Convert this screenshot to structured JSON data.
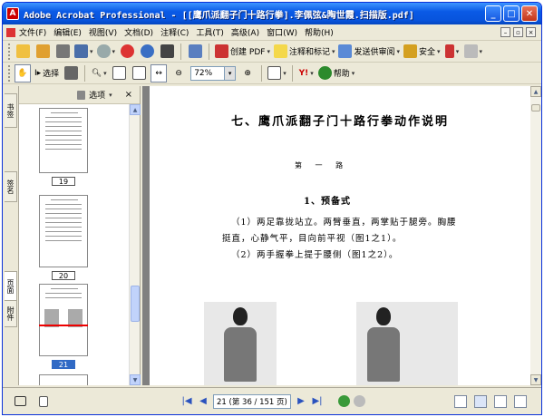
{
  "window": {
    "title": "Adobe Acrobat Professional - [[鹰爪派翻子门十路行拳].李佩弦&陶世霞.扫描版.pdf]",
    "app_icon": "acrobat-icon"
  },
  "menu": {
    "items": [
      "文件(F)",
      "编辑(E)",
      "视图(V)",
      "文档(D)",
      "注释(C)",
      "工具(T)",
      "高级(A)",
      "窗口(W)",
      "帮助(H)"
    ]
  },
  "toolbar1": {
    "create_pdf": "创建 PDF",
    "comment_markup": "注释和标记",
    "send_review": "发送供审阅",
    "secure": "安全"
  },
  "toolbar2": {
    "select": "选择",
    "zoom_value": "72%",
    "help": "帮助"
  },
  "left_tabs": [
    "书签",
    "签名",
    "页面",
    "附件"
  ],
  "nav_panel": {
    "options": "选项",
    "close": "×",
    "thumb_labels": [
      "19",
      "20",
      "21"
    ],
    "selected": "21"
  },
  "document": {
    "title": "七、鹰爪派翻子门十路行拳动作说明",
    "chapter": "第 一 路",
    "section": "1、预备式",
    "paragraphs": [
      "（1）两足靠拢站立。两臂垂直，两掌贴于腿旁。胸腰",
      "挺直，心静气平，目向前平视（图1之1）。",
      "（2）两手握拳上提于腰侧（图1之2）。"
    ]
  },
  "status": {
    "page_display": "21 (第 36 / 151 页)"
  },
  "colors": {
    "title_bar": "#0a5ae6",
    "selected_thumb": "#316ac5"
  }
}
